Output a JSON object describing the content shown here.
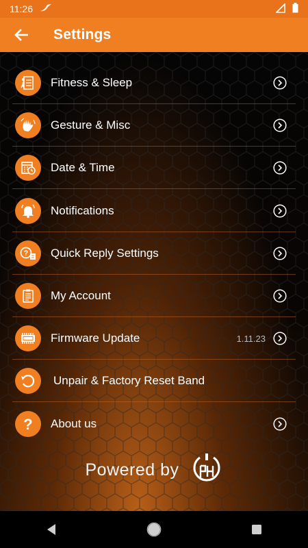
{
  "status": {
    "time": "11:26"
  },
  "appbar": {
    "title": "Settings"
  },
  "menu": [
    {
      "label": "Fitness & Sleep",
      "icon": "fitness-icon"
    },
    {
      "label": "Gesture & Misc",
      "icon": "gesture-hand-icon"
    },
    {
      "label": "Date & Time",
      "icon": "calendar-clock-icon"
    },
    {
      "label": "Notifications",
      "icon": "bell-icon"
    },
    {
      "label": "Quick Reply Settings",
      "icon": "quick-reply-icon"
    },
    {
      "label": "My Account",
      "icon": "clipboard-icon"
    },
    {
      "label": "Firmware Update",
      "icon": "chip-icon",
      "version": "1.11.23"
    },
    {
      "label": "Unpair & Factory Reset Band",
      "icon": "reset-icon"
    },
    {
      "label": "About us",
      "icon": "question-icon"
    }
  ],
  "footer": {
    "powered_text": "Powered by"
  },
  "colors": {
    "accent": "#f07f22",
    "statusbar": "#e8731b"
  }
}
